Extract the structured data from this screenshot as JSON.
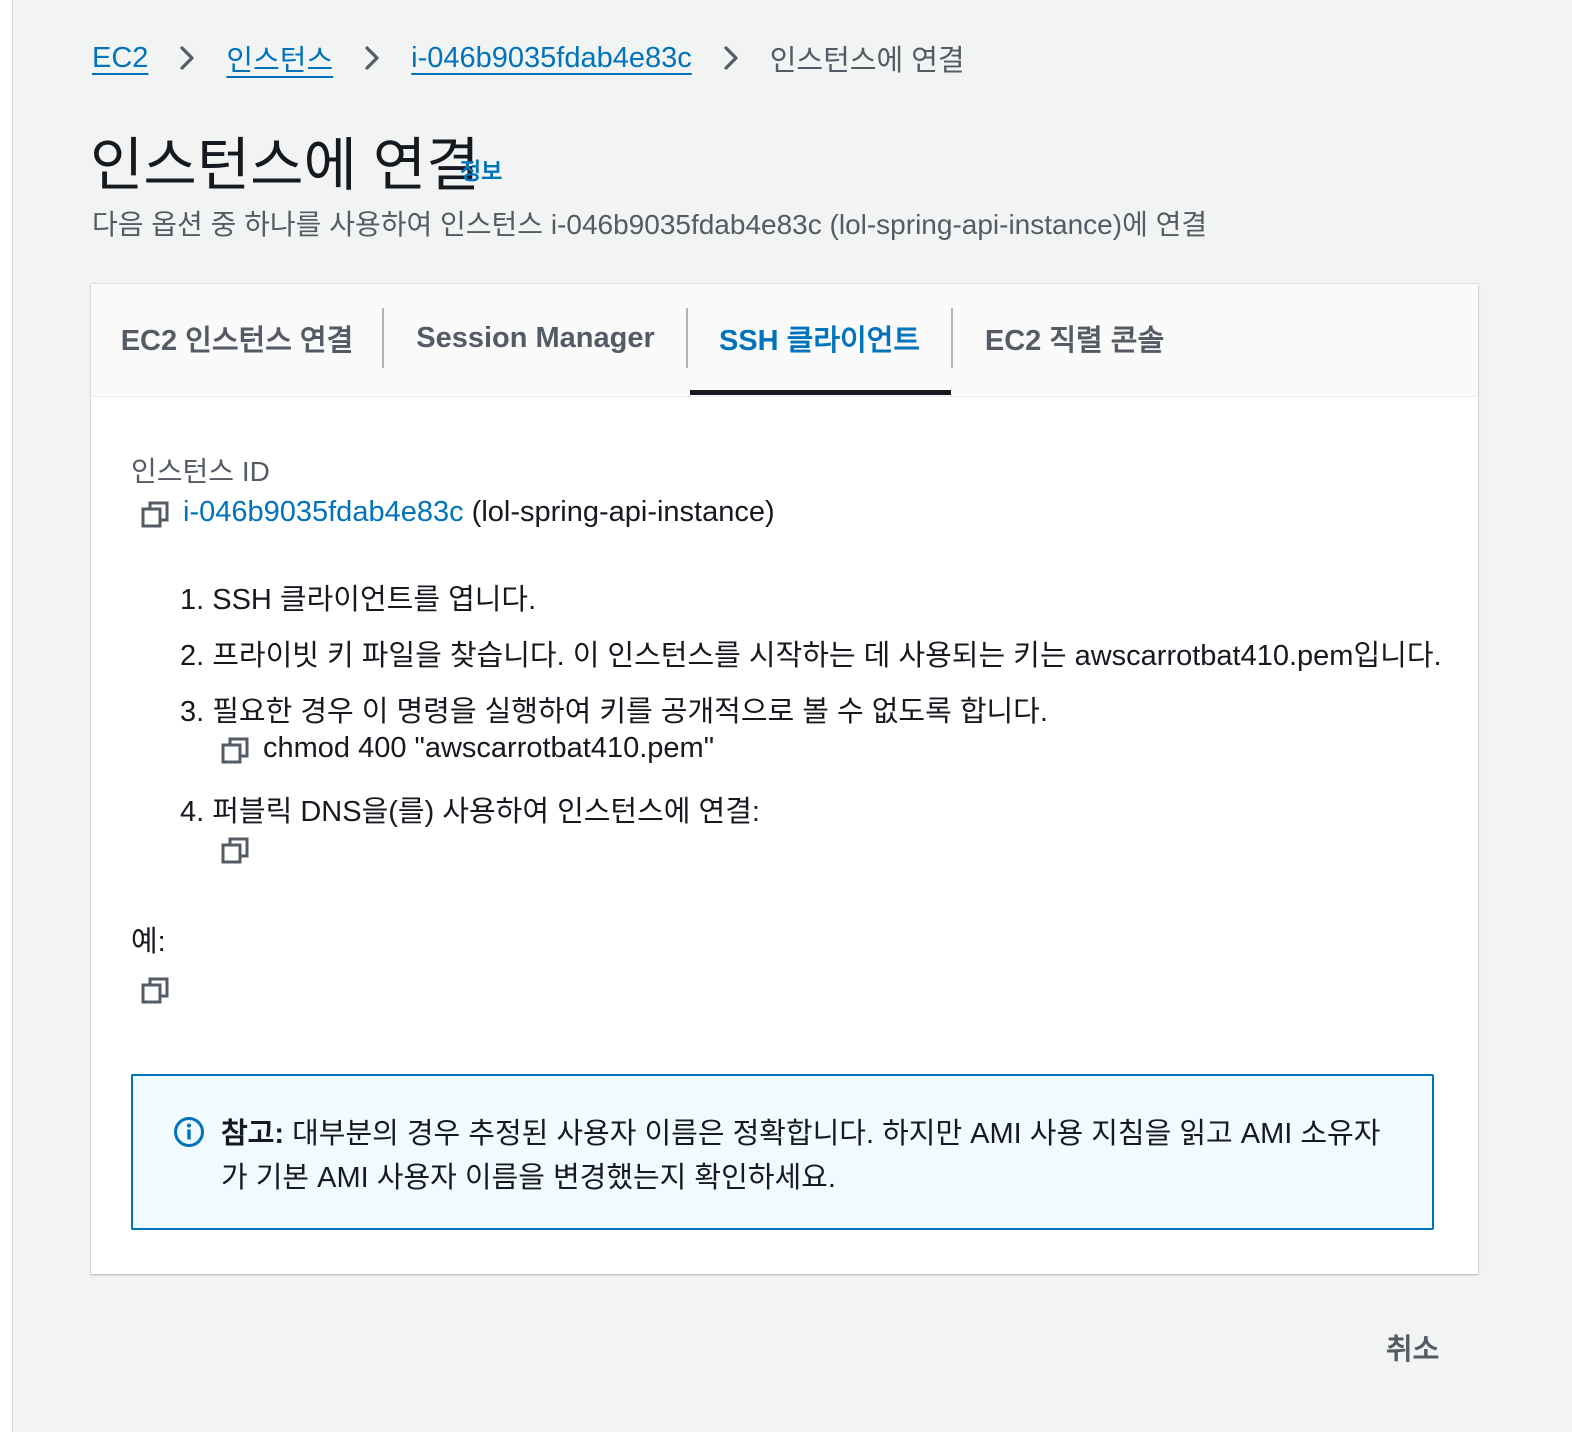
{
  "breadcrumb": {
    "items": [
      "EC2",
      "인스턴스",
      "i-046b9035fdab4e83c"
    ],
    "current": "인스턴스에 연결"
  },
  "header": {
    "title": "인스턴스에 연결",
    "info_link": "정보",
    "description": "다음 옵션 중 하나를 사용하여 인스턴스 i-046b9035fdab4e83c (lol-spring-api-instance)에 연결"
  },
  "tabs": [
    {
      "label": "EC2 인스턴스 연결",
      "active": false
    },
    {
      "label": "Session Manager",
      "active": false
    },
    {
      "label": "SSH 클라이언트",
      "active": true
    },
    {
      "label": "EC2 직렬 콘솔",
      "active": false
    }
  ],
  "ssh": {
    "instance_id_label": "인스턴스 ID",
    "instance_id": "i-046b9035fdab4e83c",
    "instance_name": "(lol-spring-api-instance)",
    "steps": [
      "1. SSH 클라이언트를 엽니다.",
      "2. 프라이빗 키 파일을 찾습니다. 이 인스턴스를 시작하는 데 사용되는 키는 awscarrotbat410.pem입니다.",
      "3. 필요한 경우 이 명령을 실행하여 키를 공개적으로 볼 수 없도록 합니다.",
      "4. 퍼블릭 DNS을(를) 사용하여 인스턴스에 연결:"
    ],
    "chmod_command": "chmod 400 \"awscarrotbat410.pem\"",
    "example_label": "예:"
  },
  "note": {
    "label": "참고:",
    "text": " 대부분의 경우 추정된 사용자 이름은 정확합니다. 하지만 AMI 사용 지침을 읽고 AMI 소유자가 기본 AMI 사용자 이름을 변경했는지 확인하세요."
  },
  "footer": {
    "cancel_label": "취소"
  },
  "icons": {
    "copy": "copy-icon",
    "info": "info-circle-icon",
    "separator": "chevron-right-icon"
  },
  "colors": {
    "link": "#0073bb",
    "note_border": "#0073bb",
    "note_bg": "#f1faff",
    "page_bg": "#f2f3f3"
  }
}
